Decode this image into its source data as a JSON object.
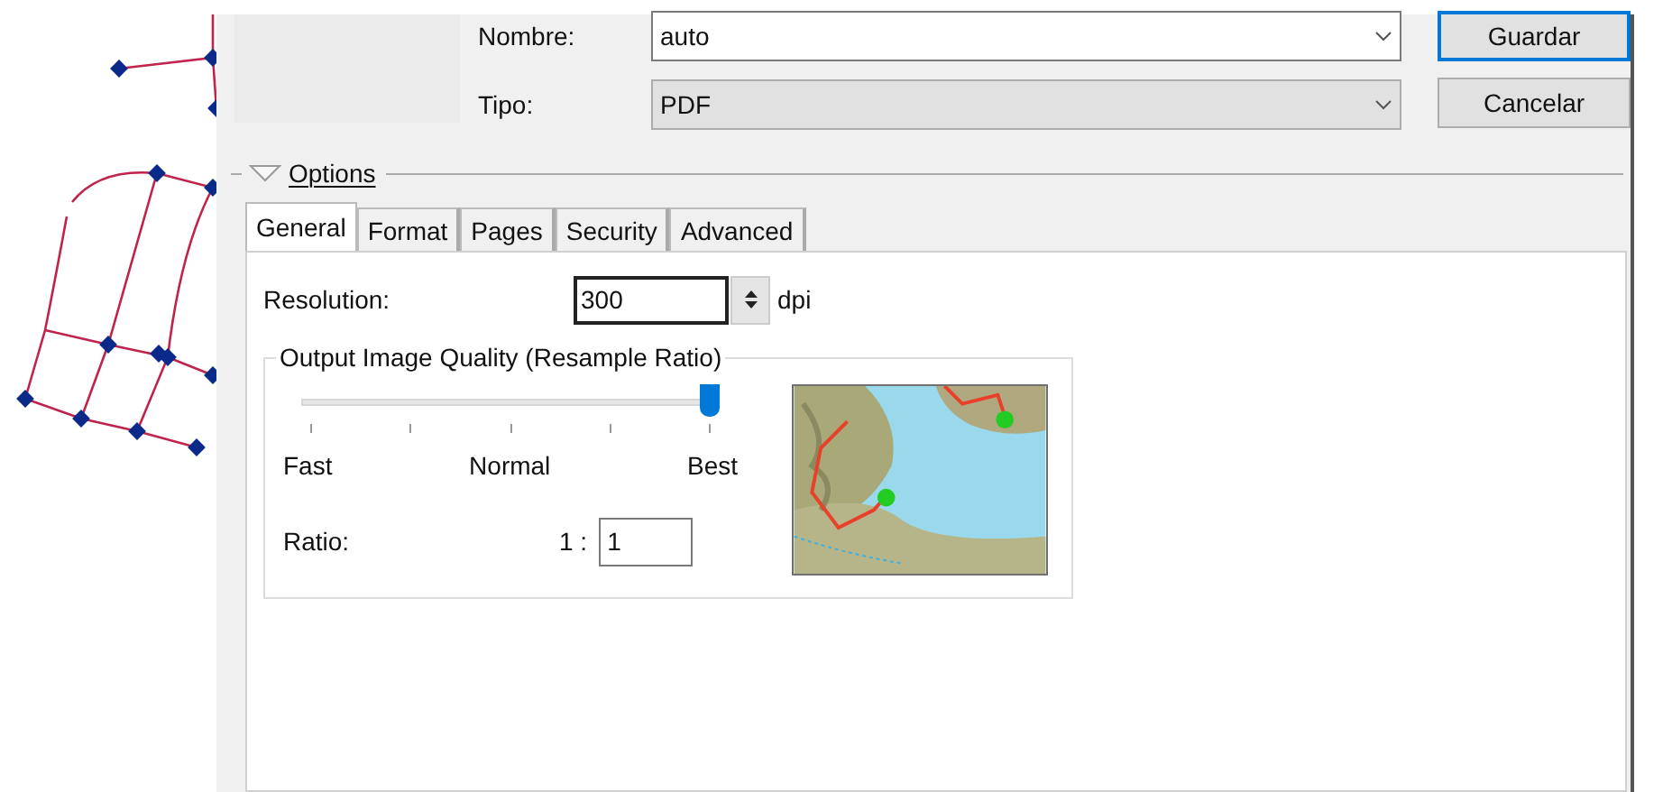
{
  "fields": [
    {
      "label": "Nombre:",
      "value": "auto",
      "disabled": false
    },
    {
      "label": "Tipo:",
      "value": "PDF",
      "disabled": true
    }
  ],
  "buttons": [
    {
      "label": "Guardar",
      "default": true
    },
    {
      "label": "Cancelar",
      "default": false
    }
  ],
  "options": {
    "title": "Options",
    "expanded": true
  },
  "tabs": [
    {
      "label": "General",
      "selected": true
    },
    {
      "label": "Format",
      "selected": false
    },
    {
      "label": "Pages",
      "selected": false
    },
    {
      "label": "Security",
      "selected": false
    },
    {
      "label": "Advanced",
      "selected": false
    }
  ],
  "resolution": {
    "label": "Resolution:",
    "value": "300",
    "unit": "dpi"
  },
  "quality": {
    "title": "Output Image Quality (Resample Ratio)",
    "level": 1,
    "tick_labels": [
      "Fast",
      "Normal",
      "Best"
    ],
    "ratio_label": "Ratio:",
    "ratio_prefix": "1 :",
    "ratio_value": "1"
  }
}
